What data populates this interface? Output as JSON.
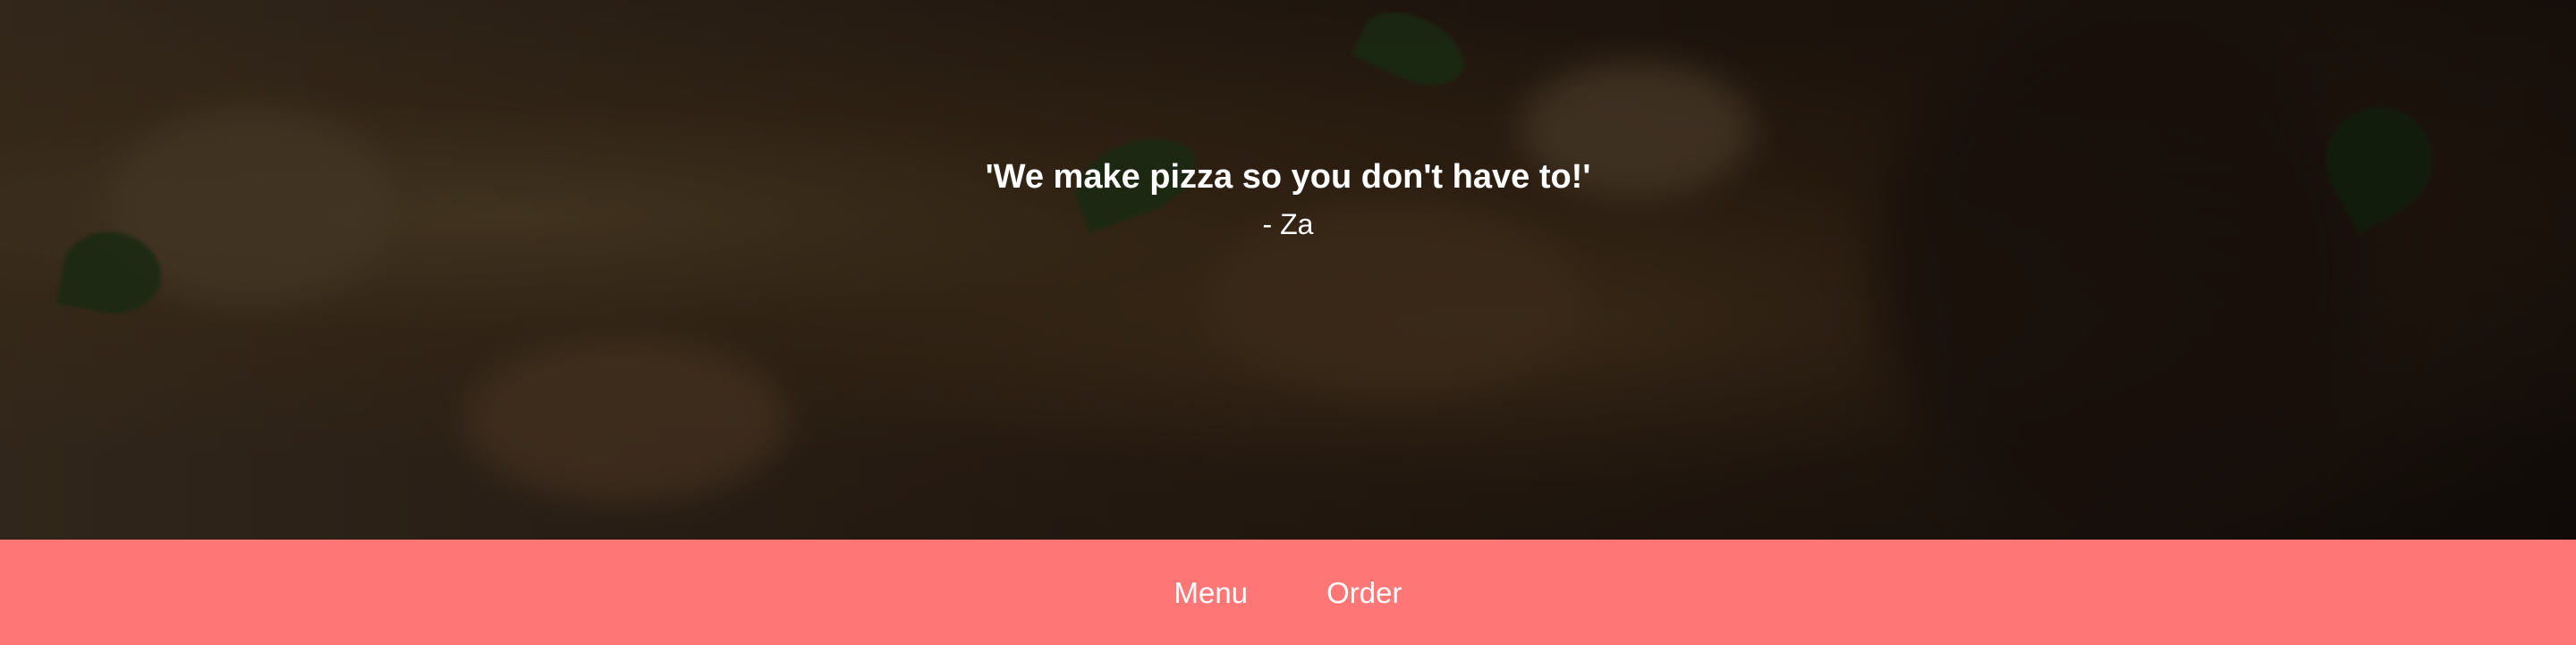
{
  "hero": {
    "quote": "'We make pizza so you don't have to!'",
    "author": "- Za"
  },
  "nav": {
    "items": [
      {
        "label": "Menu"
      },
      {
        "label": "Order"
      }
    ]
  },
  "colors": {
    "navbar_bg": "#ff7676",
    "text": "#ffffff",
    "overlay": "rgba(0,0,0,0.45)"
  }
}
